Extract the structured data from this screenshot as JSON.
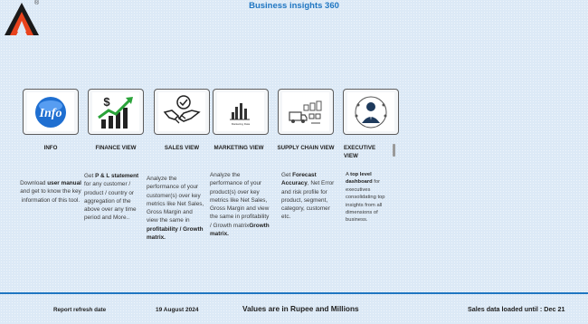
{
  "header": {
    "title": "Business insights 360",
    "logo_mark": "®"
  },
  "cards": [
    {
      "label": "INFO",
      "icon": "info-icon",
      "icon_text": "Info",
      "desc_parts": [
        {
          "t": "Download ",
          "b": false
        },
        {
          "t": "user manual",
          "b": true
        },
        {
          "t": " and get to know the key information of this tool.",
          "b": false
        }
      ]
    },
    {
      "label": "FINANCE VIEW",
      "icon": "finance-growth-icon",
      "desc_parts": [
        {
          "t": "Get  ",
          "b": false
        },
        {
          "t": "P & L statement",
          "b": true
        },
        {
          "t": " for any customer / product / country or aggregation of the above over any time period and More..",
          "b": false
        }
      ]
    },
    {
      "label": "SALES VIEW",
      "icon": "handshake-icon",
      "desc_parts": [
        {
          "t": "Analyze the performance of your customer(s) over key metrics like Net Sales, Gross Margin and view the same in ",
          "b": false
        },
        {
          "t": "profitability / Growth matrix.",
          "b": true
        }
      ]
    },
    {
      "label": "MARKETING VIEW",
      "icon": "marketing-chart-icon",
      "icon_text": "Marketing Data",
      "desc_parts": [
        {
          "t": "Analyze the performance of your product(s) over key metrics like Net Sales, Gross Margin and view the same in profitability / Growth matrix",
          "b": false
        },
        {
          "t": "Growth matrix.",
          "b": true
        }
      ]
    },
    {
      "label": "SUPPLY CHAIN VIEW",
      "icon": "supply-chain-icon",
      "desc_parts": [
        {
          "t": "Get ",
          "b": false
        },
        {
          "t": "Forecast Accuracy",
          "b": true
        },
        {
          "t": ", Net Error and risk profile for product, segment, category, customer etc.",
          "b": false
        }
      ]
    },
    {
      "label": "EXECUTIVE VIEW",
      "icon": "executive-person-icon",
      "desc_parts": [
        {
          "t": "A ",
          "b": false
        },
        {
          "t": "top level dashboard",
          "b": true
        },
        {
          "t": " for executives consolidating top insights from all dimensions of business.",
          "b": false
        }
      ]
    }
  ],
  "footer": {
    "refresh_label": "Report refresh date",
    "refresh_date": "19 August 2024",
    "currency_note": "Values are in Rupee and Millions",
    "sales_loaded": "Sales data loaded until : Dec 21"
  }
}
